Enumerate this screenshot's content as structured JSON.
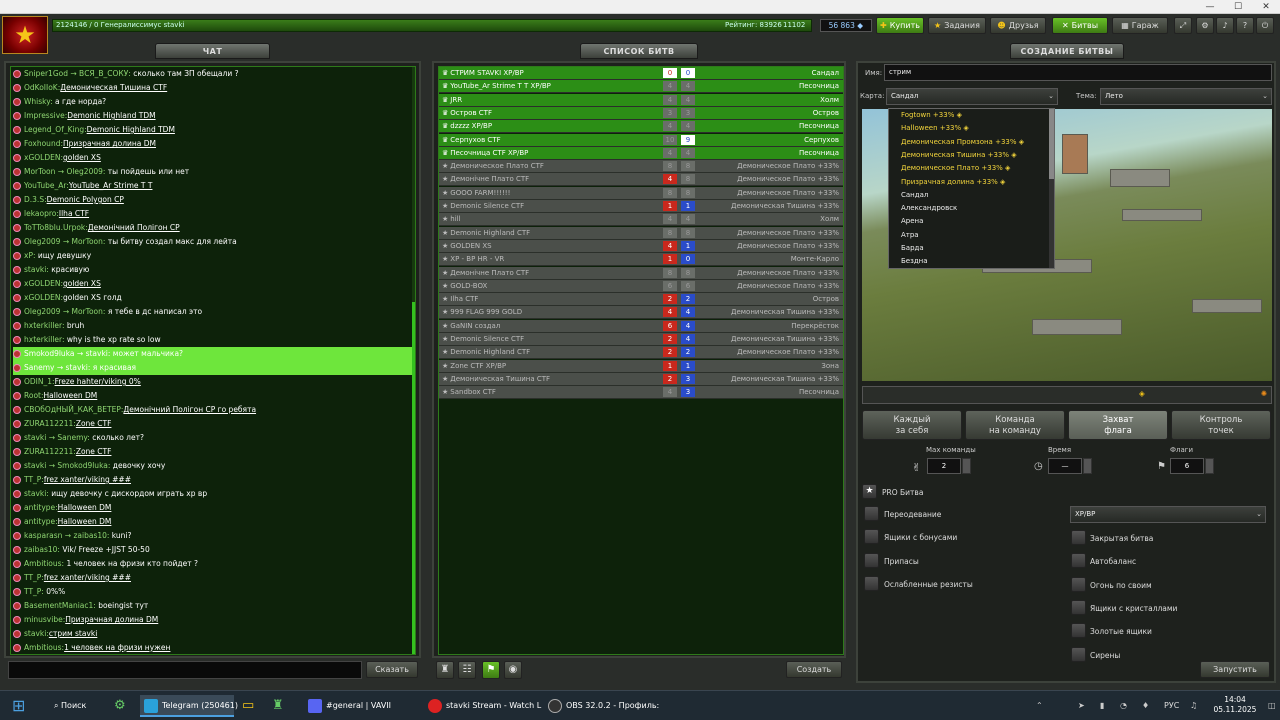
{
  "window": {
    "min": "—",
    "max": "☐",
    "close": "✕"
  },
  "top": {
    "user_line": "2124146 / 0  Генералиссимус stavki",
    "rating": "Рейтинг: 83926",
    "rank_pos": "11102",
    "crystals": "56 863",
    "buy": "Купить",
    "tasks": "Задания",
    "friends": "Друзья",
    "battles": "Битвы",
    "garage": "Гараж"
  },
  "chat": {
    "tab": "ЧАТ",
    "send": "Сказать",
    "messages": [
      {
        "nick": "Sniper1God → ",
        "to": "ВСЯ_В_СОКУ:",
        "text": " сколько там ЗП обещали ?",
        "type": "plain"
      },
      {
        "nick": "OdKoIIoK:",
        "text": "Демоническая Тишина CTF",
        "type": "link"
      },
      {
        "nick": "Whisky:",
        "text": " а где норда?",
        "type": "plain"
      },
      {
        "nick": "Impressive:",
        "text": "Demonic Highland TDM",
        "type": "link"
      },
      {
        "nick": "Legend_Of_King:",
        "text": "Demonic Highland TDM",
        "type": "link"
      },
      {
        "nick": "Foxhound:",
        "text": "Призрачная долина DM",
        "type": "link"
      },
      {
        "nick": "xGOLDEN:",
        "text": "golden XS",
        "type": "link"
      },
      {
        "nick": "MorToon → ",
        "to": "Oleg2009:",
        "text": " ты пойдешь или нет",
        "type": "plain"
      },
      {
        "nick": "YouTube_Ar:",
        "text": "YouTube_Ar Strime T T",
        "type": "link"
      },
      {
        "nick": "D.3.S:",
        "text": "Demonic Polygon CP",
        "type": "link"
      },
      {
        "nick": "lekaopro:",
        "text": "Ilha CTF",
        "type": "link"
      },
      {
        "nick": "ToTTo8blu.Urpok:",
        "text": "Демонічний Полігон CP",
        "type": "link"
      },
      {
        "nick": "Oleg2009 → ",
        "to": "MorToon:",
        "text": " ты битву создал макс для лейта",
        "type": "plain"
      },
      {
        "nick": "xP:",
        "text": " ищу девушку",
        "type": "plain"
      },
      {
        "nick": "stavki:",
        "text": " красивую",
        "type": "plain"
      },
      {
        "nick": "xGOLDEN:",
        "text": "golden XS",
        "type": "link"
      },
      {
        "nick": "xGOLDEN:",
        "text": "golden XS голд",
        "type": "plain"
      },
      {
        "nick": "Oleg2009 → ",
        "to": "MorToon:",
        "text": " я тебе в дс написал это",
        "type": "plain"
      },
      {
        "nick": "hxterkiller:",
        "text": " bruh",
        "type": "plain"
      },
      {
        "nick": "hxterkiller:",
        "text": " why is the xp rate so low",
        "type": "plain"
      },
      {
        "nick": "Smokod9luka → ",
        "to": "stavki:",
        "text": " может мальчика?",
        "type": "hl"
      },
      {
        "nick": "Sanemy → ",
        "to": "stavki:",
        "text": " я красивая",
        "type": "hl"
      },
      {
        "nick": "ODIN_1:",
        "text": "Freze hahter/viking 0%",
        "type": "link"
      },
      {
        "nick": "Root:",
        "text": "Halloween DM",
        "type": "link"
      },
      {
        "nick": "СВОбОдНЫЙ_КАК_ВЕТЕР:",
        "text": "Демонічний Полігон CP го ребята",
        "type": "link"
      },
      {
        "nick": "ZURA112211:",
        "text": "Zone CTF",
        "type": "link"
      },
      {
        "nick": "stavki → ",
        "to": "Sanemy:",
        "text": " сколько лет?",
        "type": "plain"
      },
      {
        "nick": "ZURA112211:",
        "text": "Zone CTF",
        "type": "link"
      },
      {
        "nick": "stavki → ",
        "to": "Smokod9luka:",
        "text": " девочку хочу",
        "type": "plain"
      },
      {
        "nick": "TT_P:",
        "text": "frez xanter/viking ###",
        "type": "link"
      },
      {
        "nick": "stavki:",
        "text": " ищу девочку с дискордом играть хр вр",
        "type": "plain"
      },
      {
        "nick": "antitype:",
        "text": "Halloween DM",
        "type": "link"
      },
      {
        "nick": "antitype:",
        "text": "Halloween DM",
        "type": "link"
      },
      {
        "nick": "kasparasn → ",
        "to": "zaibas10:",
        "text": " kuni?",
        "type": "plain"
      },
      {
        "nick": "zaibas10:",
        "text": " Vik/ Freeze +JJST 50-50",
        "type": "plain"
      },
      {
        "nick": "Ambitious:",
        "text": " 1 человек на фризи кто пойдет ?",
        "type": "plain"
      },
      {
        "nick": "TT_P:",
        "text": "frez xanter/viking ###",
        "type": "link"
      },
      {
        "nick": "TT_P:",
        "text": " 0%%",
        "type": "plain"
      },
      {
        "nick": "BasementManiac1:",
        "text": " boeingist тут",
        "type": "plain"
      },
      {
        "nick": "minusvibe:",
        "text": "Призрачная долина DM",
        "type": "link"
      },
      {
        "nick": "stavki:",
        "text": "стрим stavki",
        "type": "link"
      },
      {
        "nick": "Ambitious:",
        "text": "1 человек на фризи нужен",
        "type": "link"
      }
    ]
  },
  "battles": {
    "tab": "СПИСОК БИТВ",
    "create": "Создать",
    "rows": [
      {
        "name": "СТРИМ STAVKI XP/BP",
        "a": "0",
        "b": "0",
        "map": "Сандал",
        "style": "g"
      },
      {
        "name": "YouTube_Ar Strime T T XP/BP",
        "a": "4",
        "b": "4",
        "map": "Песочница",
        "style": "g",
        "za": true,
        "zb": true
      },
      {
        "name": "JRR",
        "a": "4",
        "b": "4",
        "map": "Холм",
        "style": "g",
        "za": true,
        "zb": true
      },
      {
        "name": "Остров CTF",
        "a": "3",
        "b": "3",
        "map": "Остров",
        "style": "g",
        "za": true,
        "zb": true
      },
      {
        "name": "dzzzz XP/BP",
        "a": "4",
        "b": "4",
        "map": "Песочница",
        "style": "g",
        "za": true,
        "zb": true
      },
      {
        "name": "Серпухов CTF",
        "a": "10",
        "b": "9",
        "map": "Серпухов",
        "style": "g",
        "za": true
      },
      {
        "name": "Песочница CTF XP/BP",
        "a": "4",
        "b": "4",
        "map": "Песочница",
        "style": "g",
        "za": true,
        "zb": true
      },
      {
        "name": "Демоническое Плато CTF",
        "a": "8",
        "b": "8",
        "map": "Демоническое Плато +33%",
        "style": "d",
        "za": true,
        "zb": true
      },
      {
        "name": "Демонічне Плато CTF",
        "a": "4",
        "b": "8",
        "map": "Демоническое Плато +33%",
        "style": "d",
        "zb": true
      },
      {
        "name": "GOOO FARM!!!!!!",
        "a": "8",
        "b": "8",
        "map": "Демоническое Плато +33%",
        "style": "d",
        "za": true,
        "zb": true
      },
      {
        "name": "Demonic Silence CTF",
        "a": "1",
        "b": "1",
        "map": "Демоническая Тишина +33%",
        "style": "d"
      },
      {
        "name": "hill",
        "a": "4",
        "b": "4",
        "map": "Холм",
        "style": "d",
        "za": true,
        "zb": true
      },
      {
        "name": "Demonic Highland CTF",
        "a": "8",
        "b": "8",
        "map": "Демоническое Плато +33%",
        "style": "d",
        "za": true,
        "zb": true
      },
      {
        "name": "GOLDEN XS",
        "a": "4",
        "b": "1",
        "map": "Демоническое Плато +33%",
        "style": "d"
      },
      {
        "name": "XP - BP HR - VR",
        "a": "1",
        "b": "0",
        "map": "Монте-Карло",
        "style": "d"
      },
      {
        "name": "Демонічне Плато CTF",
        "a": "8",
        "b": "8",
        "map": "Демоническое Плато +33%",
        "style": "d",
        "za": true,
        "zb": true
      },
      {
        "name": "GOLD-BOX",
        "a": "6",
        "b": "6",
        "map": "Демоническое Плато +33%",
        "style": "d",
        "za": true,
        "zb": true
      },
      {
        "name": "Ilha CTF",
        "a": "2",
        "b": "2",
        "map": "Остров",
        "style": "d"
      },
      {
        "name": "999 FLAG 999 GOLD",
        "a": "4",
        "b": "4",
        "map": "Демоническая Тишина +33%",
        "style": "d"
      },
      {
        "name": "GaNIN создал",
        "a": "6",
        "b": "4",
        "map": "Перекрёсток",
        "style": "d"
      },
      {
        "name": "Demonic Silence CTF",
        "a": "2",
        "b": "4",
        "map": "Демоническая Тишина +33%",
        "style": "d"
      },
      {
        "name": "Demonic Highland CTF",
        "a": "2",
        "b": "2",
        "map": "Демоническое Плато +33%",
        "style": "d"
      },
      {
        "name": "Zone CTF XP/BP",
        "a": "1",
        "b": "1",
        "map": "Зона",
        "style": "d"
      },
      {
        "name": "Демоническая Тишина CTF",
        "a": "2",
        "b": "3",
        "map": "Демоническая Тишина +33%",
        "style": "d"
      },
      {
        "name": "Sandbox CTF",
        "a": "4",
        "b": "3",
        "map": "Песочница",
        "style": "d",
        "za": true
      }
    ]
  },
  "create": {
    "tab": "СОЗДАНИЕ БИТВЫ",
    "name_label": "Имя:",
    "name_value": "стрим",
    "map_label": "Карта:",
    "map_value": "Сандал",
    "theme_label": "Тема:",
    "theme_value": "Лето",
    "map_options": [
      {
        "name": "Fogtown +33% ◈",
        "y": true
      },
      {
        "name": "Halloween +33% ◈",
        "y": true
      },
      {
        "name": "Демоническая Промзона +33% ◈",
        "y": true
      },
      {
        "name": "Демоническая Тишина +33% ◈",
        "y": true
      },
      {
        "name": "Демоническое Плато +33% ◈",
        "y": true
      },
      {
        "name": "Призрачная долина +33% ◈",
        "y": true
      },
      {
        "name": "Сандал",
        "y": false
      },
      {
        "name": "Александровск",
        "y": false
      },
      {
        "name": "Арена",
        "y": false
      },
      {
        "name": "Атра",
        "y": false
      },
      {
        "name": "Барда",
        "y": false
      },
      {
        "name": "Бездна",
        "y": false
      }
    ],
    "modes": [
      {
        "l1": "Каждый",
        "l2": "за себя"
      },
      {
        "l1": "Команда",
        "l2": "на команду"
      },
      {
        "l1": "Захват",
        "l2": "флага"
      },
      {
        "l1": "Контроль",
        "l2": "точек"
      }
    ],
    "max_team_label": "Max команды",
    "max_team_value": "2",
    "time_label": "Время",
    "time_value": "—",
    "flags_label": "Флаги",
    "flags_value": "6",
    "pro_label": "PRO Битва",
    "pro_mode": "XP/BP",
    "left_options": [
      "Переодевание",
      "Ящики с бонусами",
      "Припасы",
      "Ослабленные резисты"
    ],
    "right_options": [
      "Закрытая битва",
      "Автобаланс",
      "Огонь по своим",
      "Ящики с кристаллами",
      "Золотые ящики",
      "Сирены"
    ],
    "start": "Запустить"
  },
  "taskbar": {
    "search": "Поиск",
    "items": [
      "Telegram (250461)",
      "#general | VAVII",
      "stavki Stream - Watch L",
      "OBS 32.0.2 - Профиль:"
    ],
    "lang": "РУС",
    "time": "14:04",
    "date": "05.11.2025"
  }
}
